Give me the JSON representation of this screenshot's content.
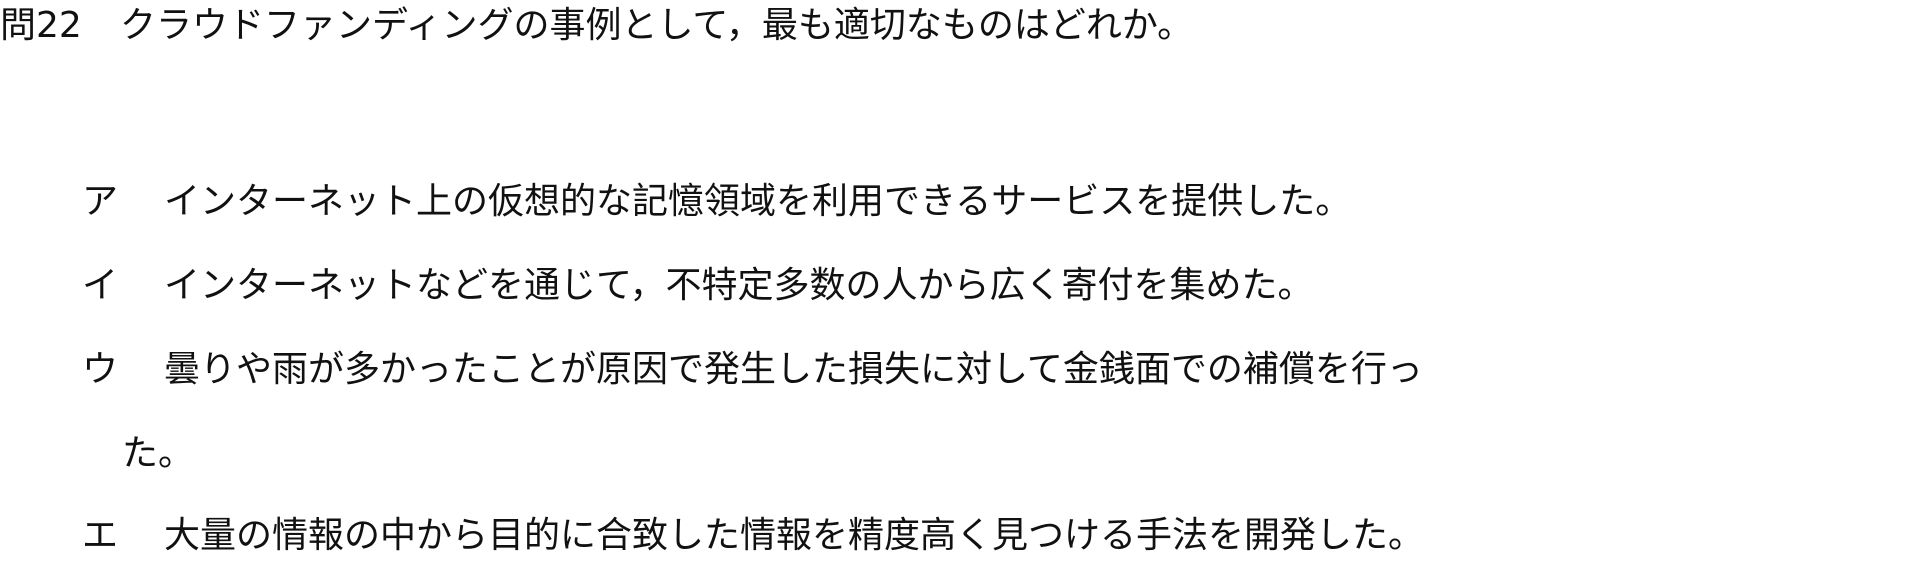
{
  "question": {
    "number": "問22",
    "text": "クラウドファンディングの事例として，最も適切なものはどれか。"
  },
  "choices": [
    {
      "label": "ア",
      "text": "インターネット上の仮想的な記憶領域を利用できるサービスを提供した。"
    },
    {
      "label": "イ",
      "text": "インターネットなどを通じて，不特定多数の人から広く寄付を集めた。"
    },
    {
      "label": "ウ",
      "text": "曇りや雨が多かったことが原因で発生した損失に対して金銭面での補償を行っ",
      "continuation": "た。"
    },
    {
      "label": "エ",
      "text": "大量の情報の中から目的に合致した情報を精度高く見つける手法を開発した。"
    }
  ]
}
